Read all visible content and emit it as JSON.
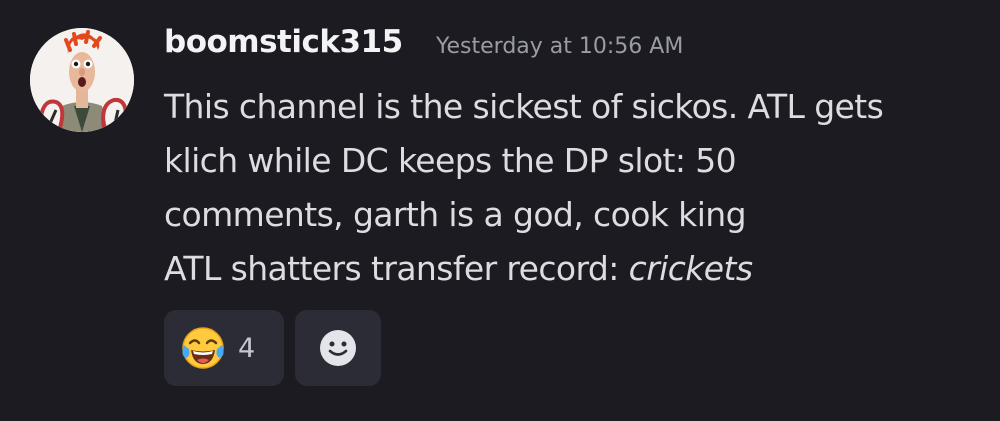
{
  "message": {
    "username": "boomstick315",
    "timestamp": "Yesterday at 10:56 AM",
    "lines": [
      "This channel is the sickest of sickos. ATL gets",
      "klich while DC keeps the DP slot: 50",
      "comments, garth is a god, cook king"
    ],
    "last_line_prefix": "ATL shatters transfer record: ",
    "last_line_emphasis": "crickets",
    "avatar_icon": "muppet-beaker-avatar"
  },
  "reactions": [
    {
      "emoji_icon": "face-with-tears-of-joy-icon",
      "count": "4"
    }
  ],
  "add_reaction_icon": "smiley-add-reaction-icon",
  "colors": {
    "background": "#1b1b21",
    "username": "#f2f3f5",
    "timestamp": "#9a9ca5",
    "body_text": "#dcdde1",
    "reaction_bg": "#2b2c35"
  }
}
